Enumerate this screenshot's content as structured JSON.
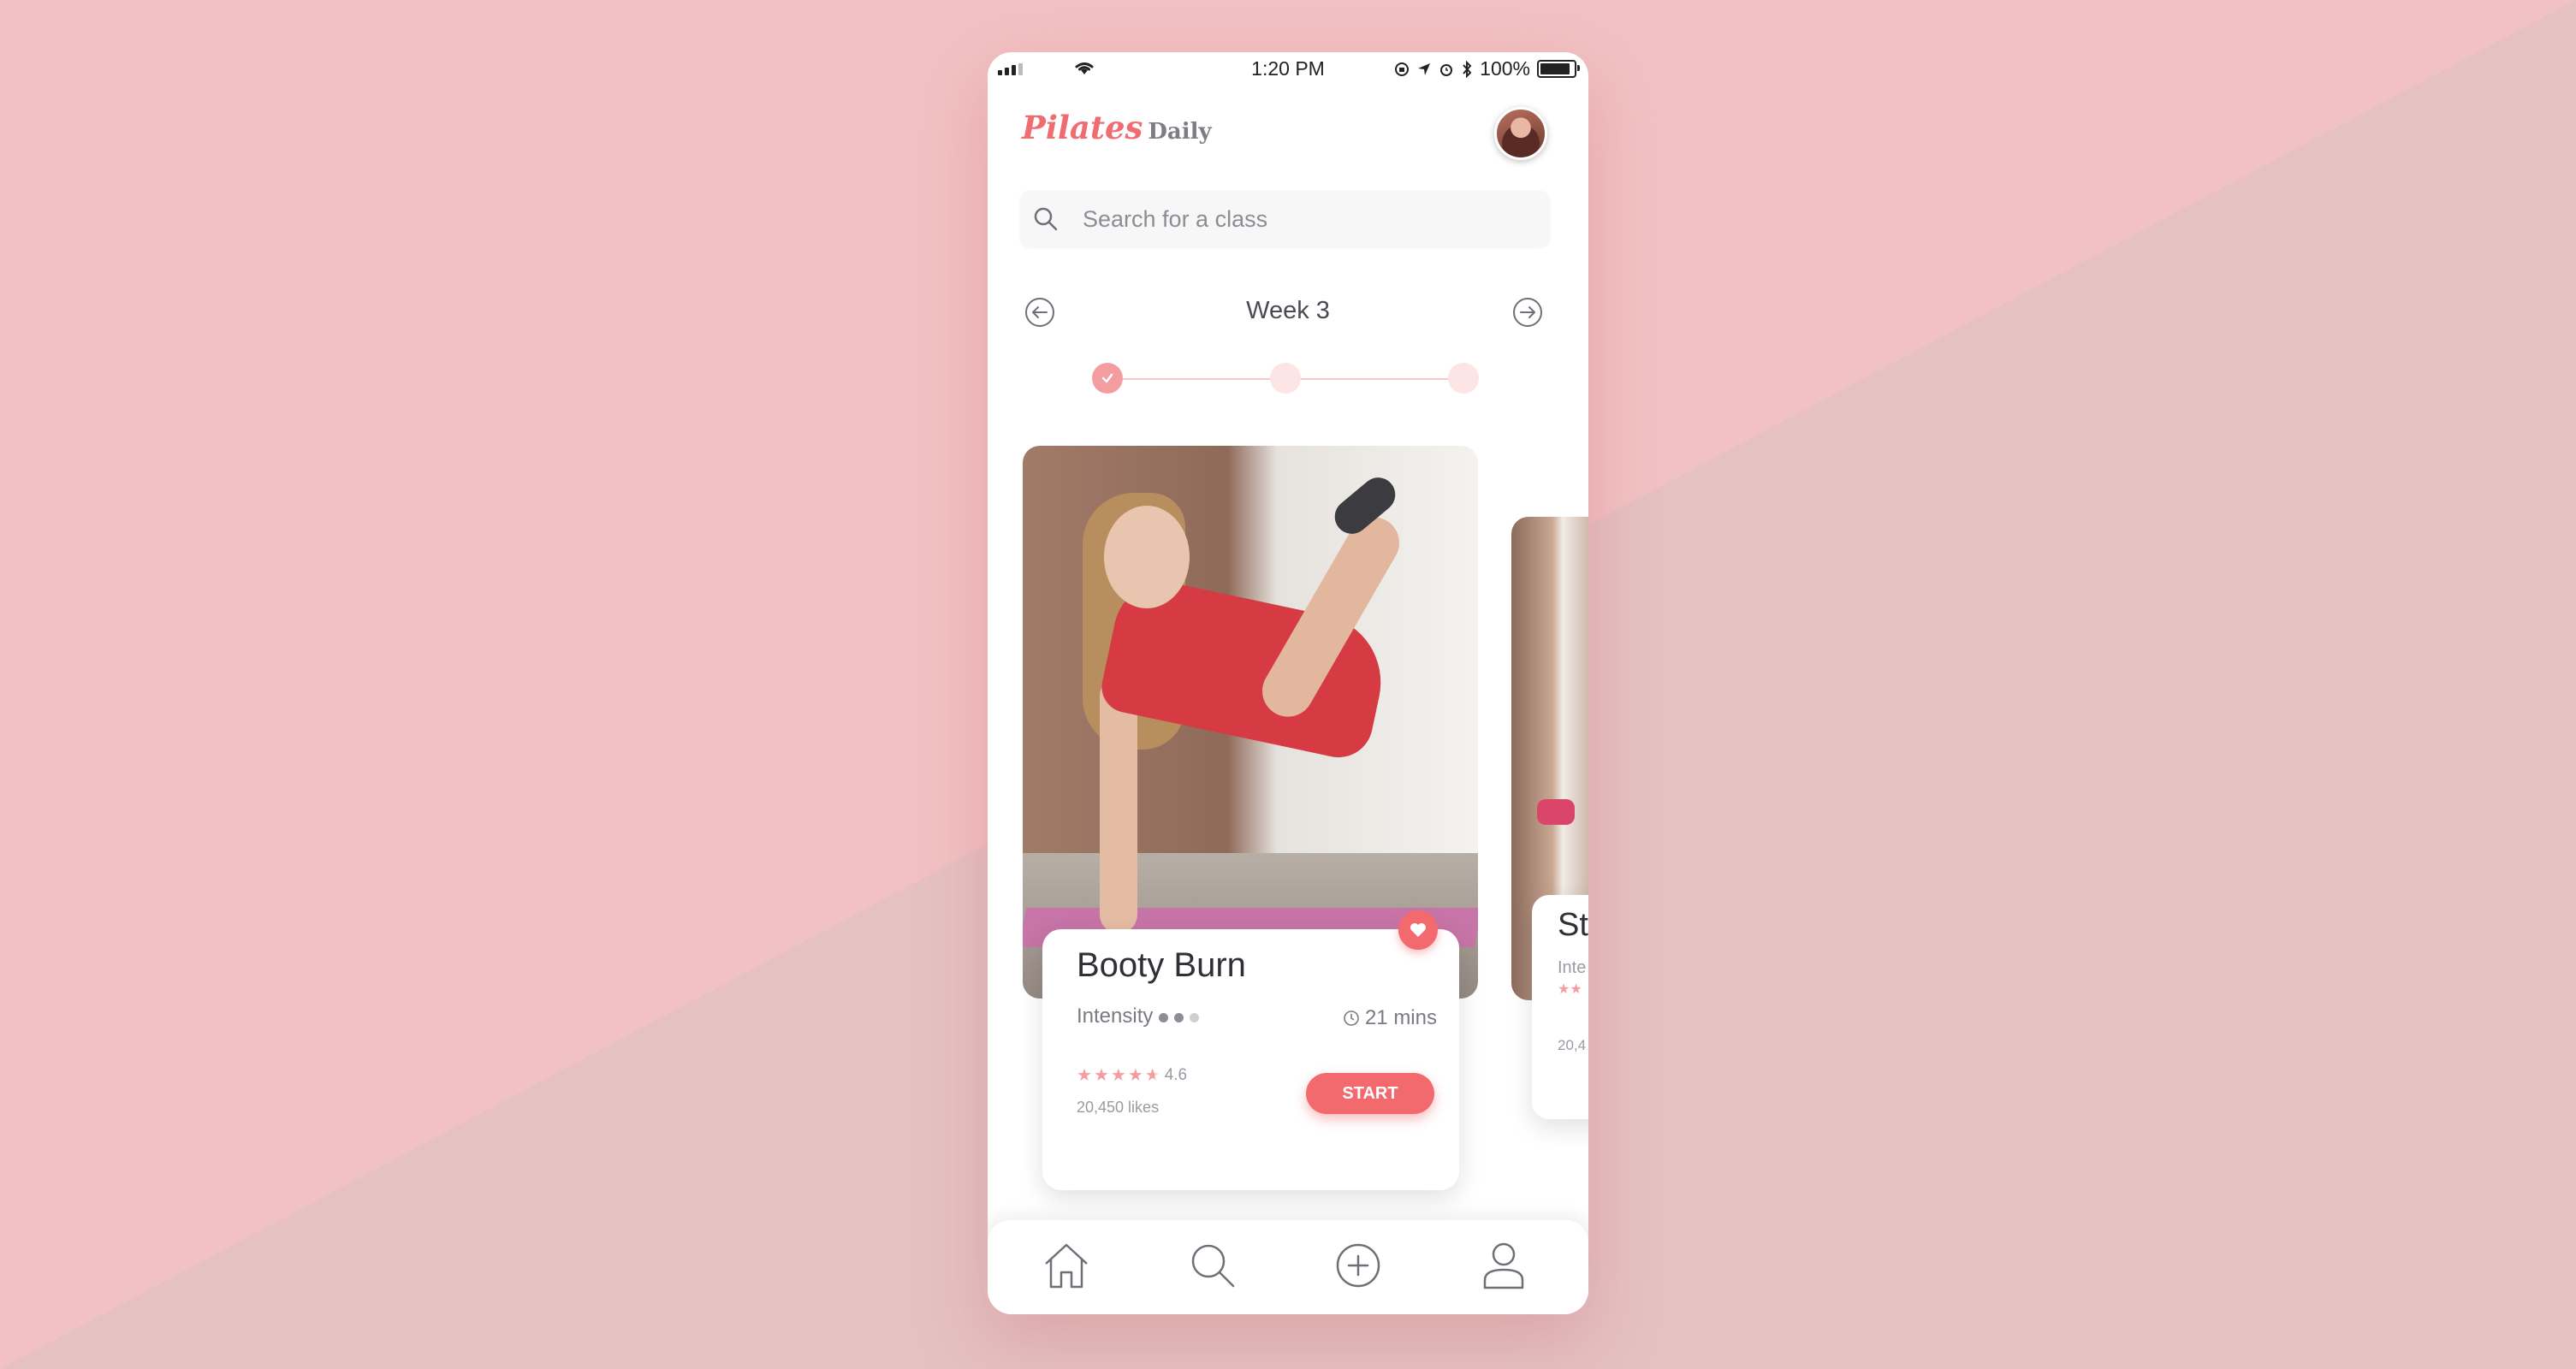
{
  "status_bar": {
    "time": "1:20 PM",
    "battery_text": "100%",
    "battery_level": 1.0,
    "icons": [
      "signal-icon",
      "wifi-icon",
      "lock-rotation-icon",
      "location-icon",
      "alarm-icon",
      "bluetooth-icon",
      "battery-icon"
    ]
  },
  "header": {
    "logo_primary": "Pilates",
    "logo_secondary": "Daily",
    "avatar_icon": "user-avatar"
  },
  "search": {
    "placeholder": "Search for a class",
    "value": "",
    "icon": "search-icon"
  },
  "week": {
    "title": "Week 3",
    "prev_icon": "arrow-left-circle-icon",
    "next_icon": "arrow-right-circle-icon",
    "steps_total": 3,
    "steps_completed": 1
  },
  "classes": [
    {
      "title": "Booty Burn",
      "intensity_label": "Intensity",
      "intensity_level": 2,
      "intensity_max": 3,
      "duration": "21 mins",
      "rating": 4.6,
      "rating_text": "4.6",
      "likes": "20,450 likes",
      "start_label": "START",
      "favorited": true
    },
    {
      "title": "St",
      "intensity_label": "Inte",
      "likes": "20,4"
    }
  ],
  "tabbar": {
    "items": [
      "home-icon",
      "search-icon",
      "add-circle-icon",
      "profile-icon"
    ],
    "active": 0
  },
  "colors": {
    "accent": "#f26a6e",
    "accent_light": "#f49da0",
    "background_pink": "#f2c1c3",
    "text_dark": "#2f2f36",
    "text_muted": "#7a7a82"
  }
}
